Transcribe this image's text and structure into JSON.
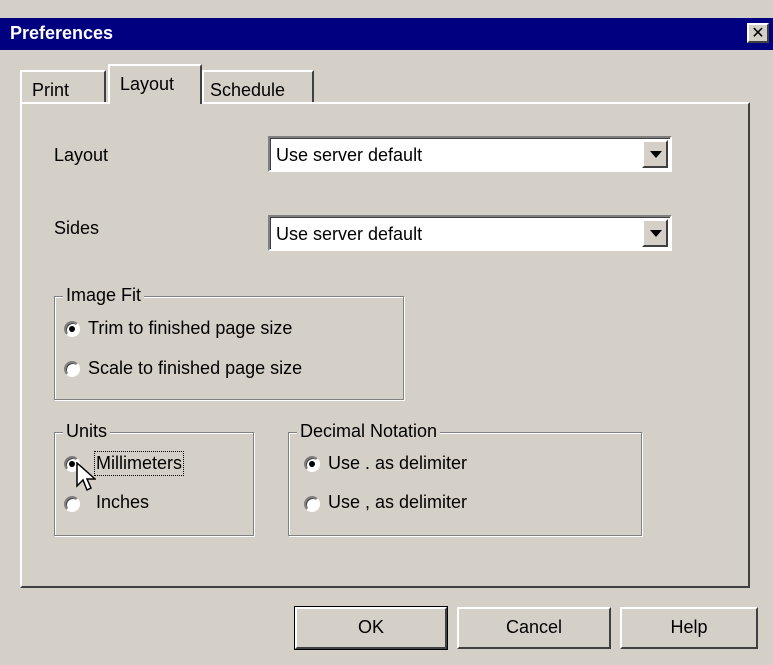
{
  "window": {
    "title": "Preferences",
    "close_glyph": "✕"
  },
  "tabs": [
    {
      "label": "Print",
      "active": false
    },
    {
      "label": "Layout",
      "active": true
    },
    {
      "label": "Schedule",
      "active": false
    }
  ],
  "layout_field": {
    "label": "Layout",
    "value": "Use server default"
  },
  "sides_field": {
    "label": "Sides",
    "value": "Use server default"
  },
  "image_fit": {
    "legend": "Image Fit",
    "options": [
      {
        "label": "Trim to finished page size",
        "checked": true
      },
      {
        "label": "Scale to finished page size",
        "checked": false
      }
    ]
  },
  "units": {
    "legend": "Units",
    "options": [
      {
        "label": "Millimeters",
        "checked": true
      },
      {
        "label": "Inches",
        "checked": false
      }
    ]
  },
  "decimal_notation": {
    "legend": "Decimal Notation",
    "options": [
      {
        "label": "Use . as delimiter",
        "checked": true
      },
      {
        "label": "Use , as delimiter",
        "checked": false
      }
    ]
  },
  "buttons": {
    "ok": "OK",
    "cancel": "Cancel",
    "help": "Help"
  },
  "icons": {
    "close": "close-icon",
    "dropdown": "chevron-down-icon",
    "cursor": "arrow-cursor-icon"
  }
}
